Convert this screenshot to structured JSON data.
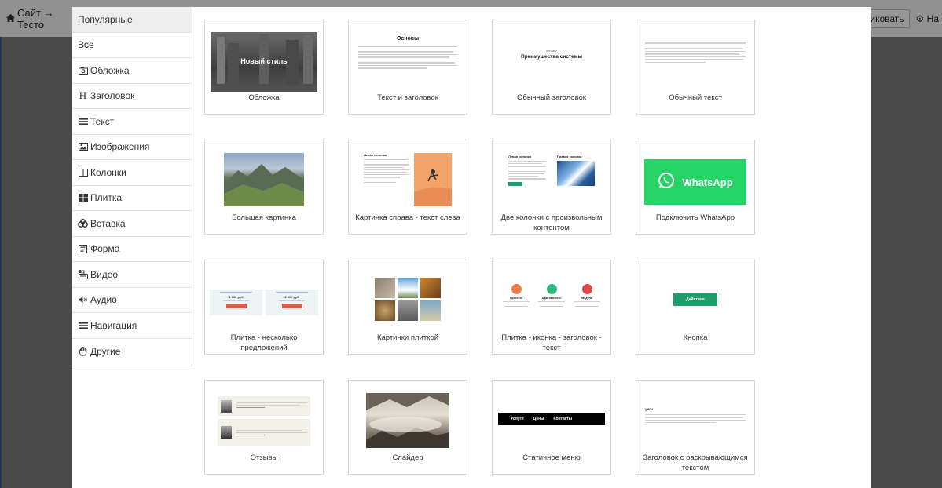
{
  "background_app": {
    "breadcrumb": "Сайт → Тесто",
    "publish_button": "убликовать",
    "settings_label": "На"
  },
  "sidebar": {
    "items": [
      {
        "label": "Популярные",
        "icon": "none"
      },
      {
        "label": "Все",
        "icon": "none"
      },
      {
        "label": "Обложка",
        "icon": "camera-icon"
      },
      {
        "label": "Заголовок",
        "icon": "heading-icon"
      },
      {
        "label": "Текст",
        "icon": "text-lines-icon"
      },
      {
        "label": "Изображения",
        "icon": "image-icon"
      },
      {
        "label": "Колонки",
        "icon": "columns-icon"
      },
      {
        "label": "Плитка",
        "icon": "tiles-icon"
      },
      {
        "label": "Вставка",
        "icon": "puzzle-icon"
      },
      {
        "label": "Форма",
        "icon": "form-icon"
      },
      {
        "label": "Видео",
        "icon": "youtube-icon"
      },
      {
        "label": "Аудио",
        "icon": "speaker-icon"
      },
      {
        "label": "Навигация",
        "icon": "menu-icon"
      },
      {
        "label": "Другие",
        "icon": "hand-icon"
      }
    ]
  },
  "blocks": [
    {
      "caption": "Обложка",
      "thumb_text": "Новый стиль"
    },
    {
      "caption": "Текст и заголовок",
      "thumb_text": "Основы"
    },
    {
      "caption": "Обычный заголовок",
      "thumb_text": "Преимущества системы",
      "thumb_subtext": "основы"
    },
    {
      "caption": "Обычный текст"
    },
    {
      "caption": "Большая картинка"
    },
    {
      "caption": "Картинка справа - текст слева",
      "thumb_text": "Левая колонка"
    },
    {
      "caption": "Две колонки с произвольным контентом",
      "thumb_text": "Левая колонка",
      "thumb_text2": "Правая колонка"
    },
    {
      "caption": "Подключить WhatsApp",
      "thumb_text": "WhatsApp"
    },
    {
      "caption": "Плитка - несколько предложений",
      "thumb_text": "1 000 руб",
      "thumb_text2": "2 000 руб"
    },
    {
      "caption": "Картинки плиткой"
    },
    {
      "caption": "Плитка - иконка - заголовок - текст",
      "thumb_text": "Простота",
      "thumb_text2": "Адаптивность",
      "thumb_text3": "Модули"
    },
    {
      "caption": "Кнопка",
      "thumb_text": "Действие"
    },
    {
      "caption": "Отзывы"
    },
    {
      "caption": "Слайдер"
    },
    {
      "caption": "Статичное меню",
      "menu_items": [
        "Услуги",
        "Цены",
        "Контакты"
      ]
    },
    {
      "caption": "Заголовок с раскрывающимся текстом",
      "thumb_text": "уиги"
    }
  ],
  "colors": {
    "whatsapp_green": "#25d366",
    "button_green": "#1e9e6a",
    "price_red": "#e25a4a",
    "icon_orange": "#f07c4a",
    "icon_green": "#34b77a",
    "icon_red": "#e04848"
  }
}
